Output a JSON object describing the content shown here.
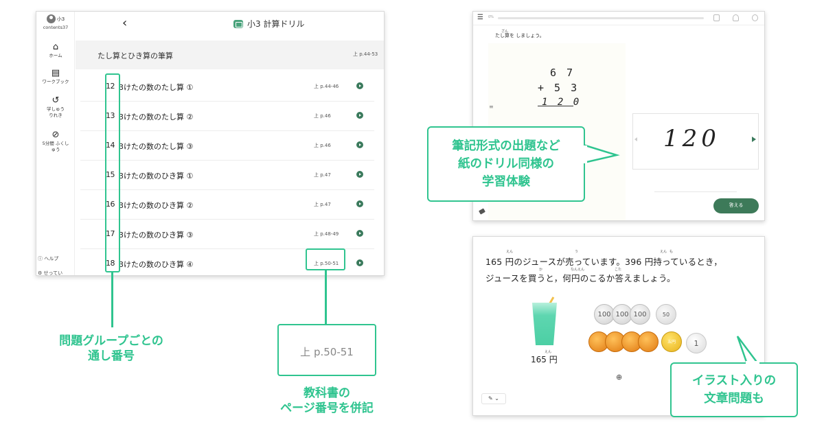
{
  "left_app": {
    "user_name": "小3",
    "user_id": "contents37",
    "title": "小3 計算ドリル",
    "sidebar": [
      {
        "icon": "home-icon",
        "label": "ホーム"
      },
      {
        "icon": "workbook-icon",
        "label": "ワークブック"
      },
      {
        "icon": "history-icon",
        "label": "学しゅう りれき"
      },
      {
        "icon": "check-circle-icon",
        "label": "5分間 ふくしゅう"
      }
    ],
    "help_label": "ヘルプ",
    "settings_label": "せってい",
    "group": {
      "title": "たし算とひき算の筆算",
      "page": "上 p.44-53"
    },
    "rows": [
      {
        "num": "12",
        "label": "3けたの数のたし算 ①",
        "page": "上 p.44-46"
      },
      {
        "num": "13",
        "label": "3けたの数のたし算 ②",
        "page": "上 p.46"
      },
      {
        "num": "14",
        "label": "3けたの数のたし算 ③",
        "page": "上 p.46"
      },
      {
        "num": "15",
        "label": "3けたの数のひき算 ①",
        "page": "上 p.47"
      },
      {
        "num": "16",
        "label": "3けたの数のひき算 ②",
        "page": "上 p.47"
      },
      {
        "num": "17",
        "label": "3けたの数のひき算 ③",
        "page": "上 p.48-49"
      },
      {
        "num": "18",
        "label": "3けたの数のひき算 ④",
        "page": "上 p.50-51"
      }
    ]
  },
  "captions": {
    "group_number": [
      "問題グループごとの",
      "通し番号"
    ],
    "zoom_page": "上 p.50-51",
    "textbook_page": [
      "教科書の",
      "ページ番号を併記"
    ],
    "bubble_hissan": [
      "筆記形式の出題など",
      "紙のドリル同様の",
      "学習体験"
    ],
    "bubble_illust": [
      "イラスト入りの",
      "文章問題も"
    ]
  },
  "right_top": {
    "progress": "0%",
    "instruction": "たし算を しましょう。",
    "instruction_ruby": "ざん",
    "top_addend": "6 7",
    "operator_line": "+ 5 3",
    "work_answer": "1 2 0",
    "handwritten": "120",
    "answer_button": "答える"
  },
  "right_bottom": {
    "line1": "165 円のジュースが売っています。396 円持っているとき，",
    "line2": "ジュースを買うと，何円のこるか答えましょう。",
    "ruby": {
      "en1": "えん",
      "u": "う",
      "en2": "えん",
      "mo": "も",
      "ka": "か",
      "nanen": "なんえん",
      "kota": "こた",
      "en3": "えん"
    },
    "price_label": "165 円",
    "coins": {
      "hundred": "100",
      "fifty": "50",
      "five": "五円",
      "one": "1"
    }
  },
  "colors": {
    "accent": "#2fc48f",
    "button": "#3d7a59"
  }
}
